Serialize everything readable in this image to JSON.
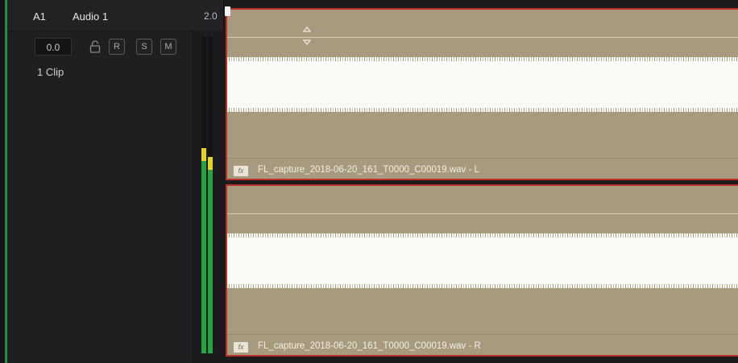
{
  "track": {
    "id": "A1",
    "name": "Audio 1",
    "format": "2.0",
    "volume": "0.0",
    "clip_count": "1 Clip",
    "buttons": {
      "record": "R",
      "solo": "S",
      "mute": "M"
    },
    "meter_levels": [
      0.65,
      0.62
    ],
    "colors": {
      "track": "#2f8a3c",
      "meter_green": "#2aa43a",
      "meter_yellow": "#e5d22a",
      "clip": "#a89a7f",
      "clip_border": "#c0302a"
    }
  },
  "clips": [
    {
      "name": "FL_capture_2018-06-20_161_T0000_C00019.wav - L",
      "fx": "fx"
    },
    {
      "name": "FL_capture_2018-06-20_161_T0000_C00019.wav - R",
      "fx": "fx"
    }
  ]
}
